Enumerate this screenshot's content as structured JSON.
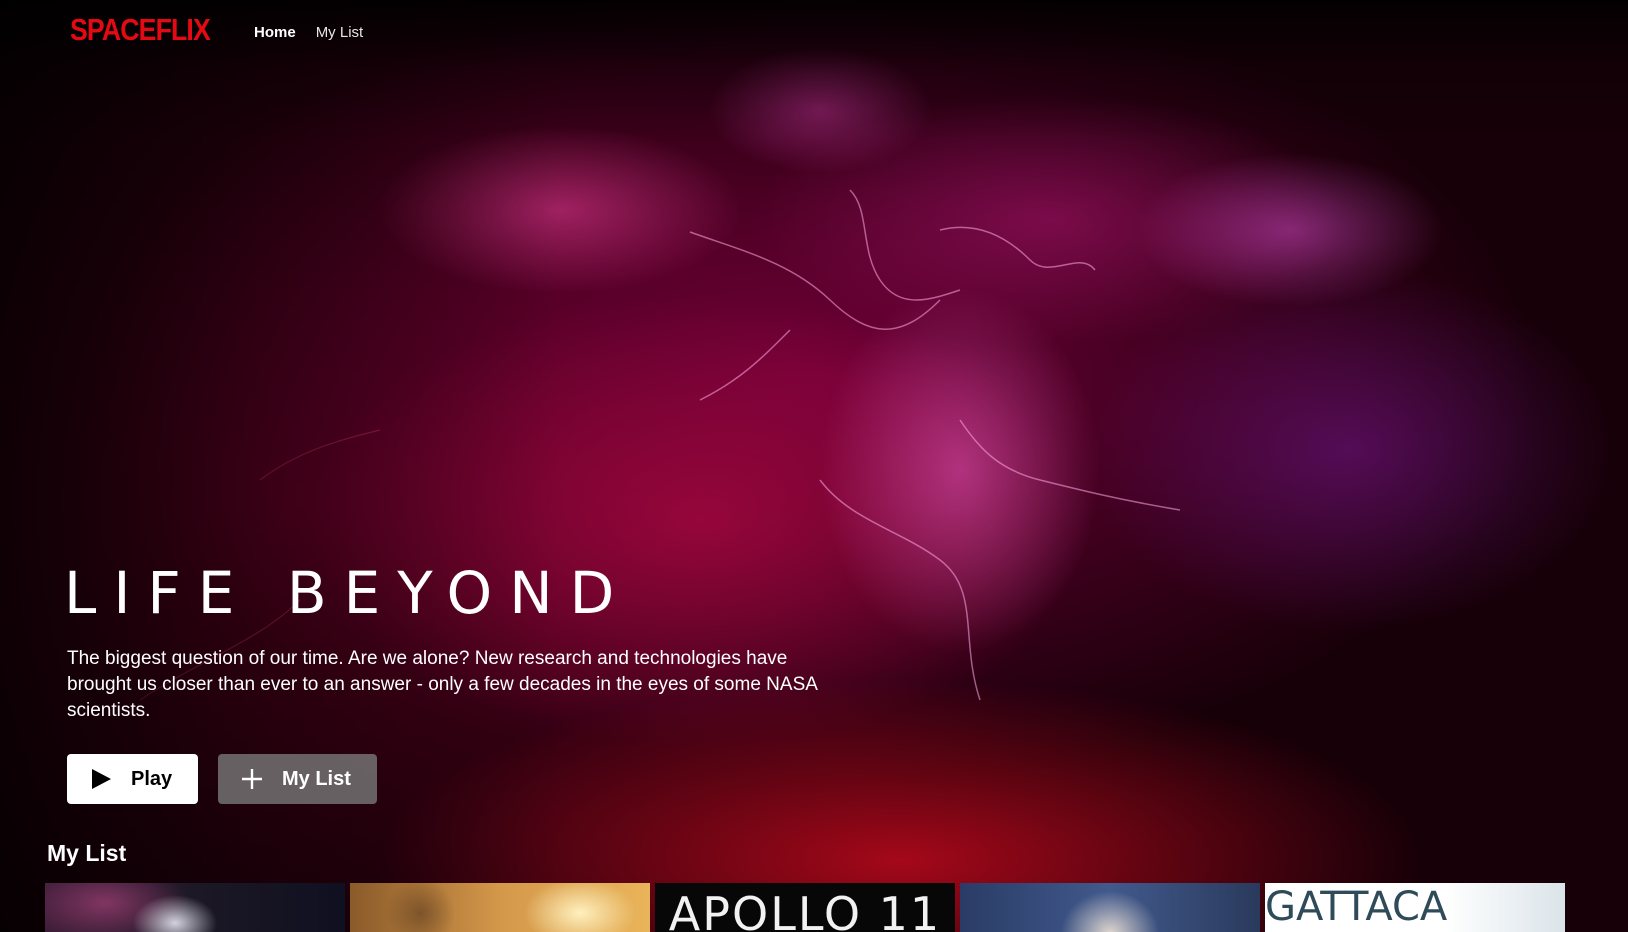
{
  "app": {
    "brand": "SPACEFLIX",
    "brand_color": "#e50914"
  },
  "nav": {
    "items": [
      {
        "label": "Home",
        "active": true
      },
      {
        "label": "My List",
        "active": false
      }
    ]
  },
  "hero": {
    "title": "LIFE BEYOND",
    "description": "The biggest question of our time. Are we alone? New research and technologies have brought us closer than ever to an answer - only a few decades in the eyes of some NASA scientists.",
    "play_label": "Play",
    "play_icon": "play-icon",
    "mylist_label": "My List",
    "mylist_icon": "plus-icon"
  },
  "row": {
    "title": "My List",
    "tiles": [
      {
        "name": "interstellar-poster",
        "text": ""
      },
      {
        "name": "astronaut-desert-poster",
        "text": ""
      },
      {
        "name": "apollo-11-poster",
        "text": "APOLLO 11"
      },
      {
        "name": "spaceballs-poster",
        "text": ""
      },
      {
        "name": "gattaca-poster",
        "text": "GATTACA"
      }
    ]
  }
}
